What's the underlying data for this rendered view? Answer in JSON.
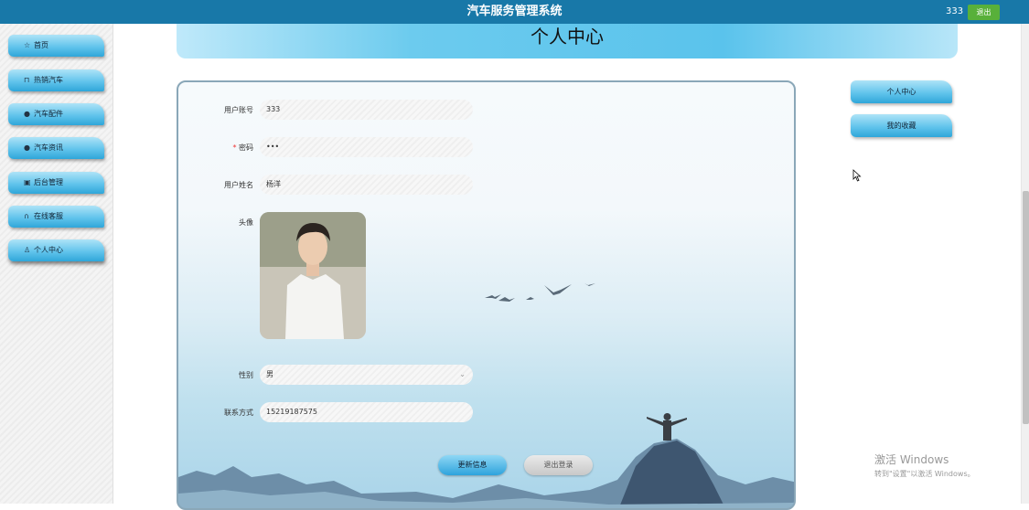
{
  "topbar": {
    "title": "汽车服务管理系统",
    "username": "333",
    "logout_label": "退出"
  },
  "sidebar": {
    "items": [
      {
        "label": "首页",
        "icon": "star-icon"
      },
      {
        "label": "热销汽车",
        "icon": "bag-icon"
      },
      {
        "label": "汽车配件",
        "icon": "info-circle-icon"
      },
      {
        "label": "汽车资讯",
        "icon": "question-circle-icon"
      },
      {
        "label": "后台管理",
        "icon": "calendar-icon"
      },
      {
        "label": "在线客服",
        "icon": "headset-icon"
      },
      {
        "label": "个人中心",
        "icon": "user-icon",
        "active": true
      }
    ]
  },
  "page": {
    "title": "个人中心"
  },
  "form": {
    "account_label": "用户账号",
    "account_value": "333",
    "password_label": "密码",
    "password_required": "*",
    "password_value": "•••",
    "name_label": "用户姓名",
    "name_value": "杨洋",
    "avatar_label": "头像",
    "gender_label": "性别",
    "gender_value": "男",
    "phone_label": "联系方式",
    "phone_value": "15219187575",
    "update_button": "更新信息",
    "logout_button": "退出登录"
  },
  "right_nav": {
    "items": [
      {
        "label": "个人中心"
      },
      {
        "label": "我的收藏"
      }
    ]
  },
  "watermark": {
    "line1": "激活 Windows",
    "line2": "转到\"设置\"以激活 Windows。"
  },
  "colors": {
    "topbar": "#1878a8",
    "accent_blue": "#62c4ec",
    "logout_green": "#58b03a"
  }
}
